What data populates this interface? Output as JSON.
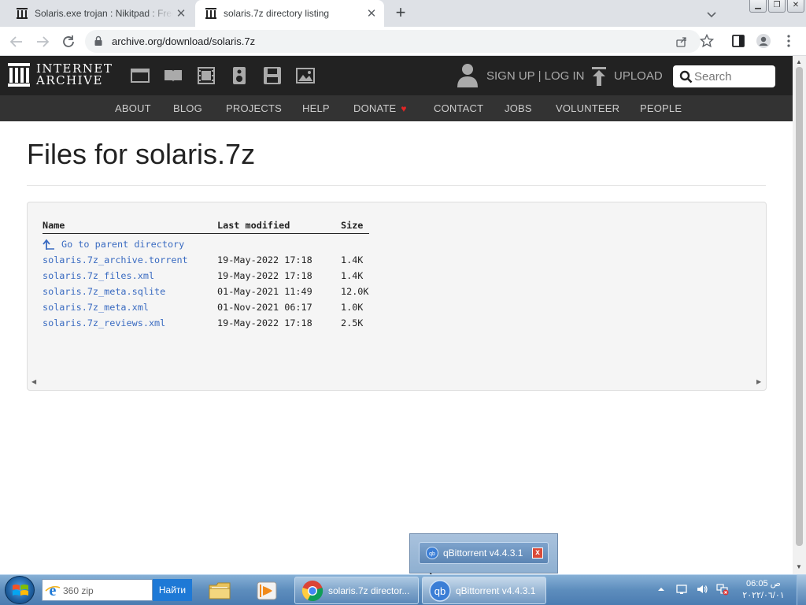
{
  "browser": {
    "tabs": [
      {
        "title": "Solaris.exe trojan : Nikitpad : Free",
        "icon": "internet-archive-icon",
        "active": false
      },
      {
        "title": "solaris.7z directory listing",
        "icon": "internet-archive-icon",
        "active": true
      }
    ],
    "url": "archive.org/download/solaris.7z"
  },
  "ia": {
    "logo_line1": "INTERNET",
    "logo_line2": "ARCHIVE",
    "media_icons": [
      "web-icon",
      "texts-icon",
      "video-icon",
      "audio-icon",
      "software-icon",
      "images-icon"
    ],
    "signin": "SIGN UP | LOG IN",
    "upload": "UPLOAD",
    "search_placeholder": "Search",
    "nav": [
      "ABOUT",
      "BLOG",
      "PROJECTS",
      "HELP",
      "DONATE",
      "CONTACT",
      "JOBS",
      "VOLUNTEER",
      "PEOPLE"
    ],
    "heart_color": "#e42525"
  },
  "page": {
    "title": "Files for solaris.7z",
    "columns": {
      "name": "Name",
      "modified": "Last modified",
      "size": "Size"
    },
    "parent_link": "Go to parent directory",
    "files": [
      {
        "name": "solaris.7z_archive.torrent",
        "modified": "19-May-2022 17:18",
        "size": "1.4K"
      },
      {
        "name": "solaris.7z_files.xml",
        "modified": "19-May-2022 17:18",
        "size": "1.4K"
      },
      {
        "name": "solaris.7z_meta.sqlite",
        "modified": "01-May-2021 11:49",
        "size": "12.0K"
      },
      {
        "name": "solaris.7z_meta.xml",
        "modified": "01-Nov-2021 06:17",
        "size": "1.0K"
      },
      {
        "name": "solaris.7z_reviews.xml",
        "modified": "19-May-2022 17:18",
        "size": "2.5K"
      }
    ],
    "link_color": "#3a6bc1"
  },
  "popup": {
    "label": "qBittorrent v4.4.3.1",
    "close": "x"
  },
  "taskbar": {
    "search_value": "360 zip",
    "search_button": "Найти",
    "tasks": [
      {
        "label": "solaris.7z director...",
        "icon": "chrome-icon"
      },
      {
        "label": "qBittorrent v4.4.3.1",
        "icon": "qbittorrent-icon"
      }
    ],
    "time": "06:05 ص",
    "date": "٢٠٢٢/٠٦/٠١"
  }
}
